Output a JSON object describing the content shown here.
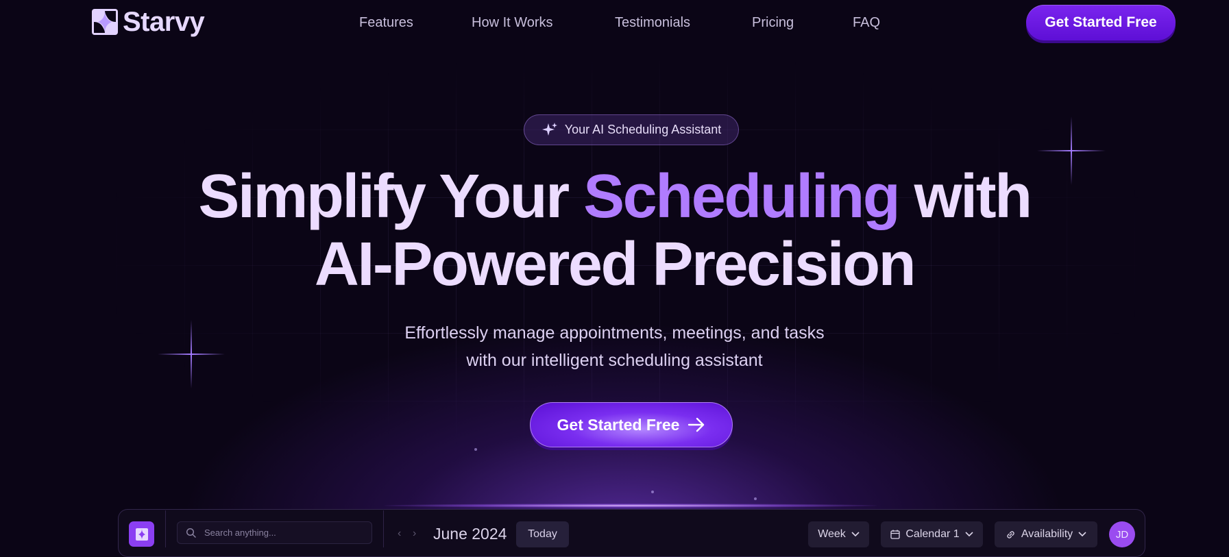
{
  "header": {
    "brand": "Starvy",
    "nav": [
      "Features",
      "How It Works",
      "Testimonials",
      "Pricing",
      "FAQ"
    ],
    "cta_label": "Get Started Free"
  },
  "hero": {
    "badge": "Your AI Scheduling Assistant",
    "title_part1": "Simplify Your ",
    "title_accent": "Scheduling",
    "title_part2": " with",
    "title_line2": "AI-Powered Precision",
    "subtitle_line1": "Effortlessly manage appointments, meetings, and tasks",
    "subtitle_line2": "with our intelligent scheduling assistant",
    "cta_label": "Get Started Free"
  },
  "app_preview": {
    "search_placeholder": "Search anything...",
    "month": "June 2024",
    "today_label": "Today",
    "view_select": "Week",
    "calendar_select": "Calendar 1",
    "availability_label": "Availability",
    "avatar_initials": "JD"
  },
  "colors": {
    "background": "#0b0516",
    "accent": "#b07cff",
    "button": "#6a18e6"
  },
  "icons": [
    "sparkle-icon",
    "arrow-right-icon",
    "search-icon",
    "calendar-icon",
    "link-icon",
    "chevron-down-icon",
    "chevron-left-icon",
    "chevron-right-icon"
  ]
}
